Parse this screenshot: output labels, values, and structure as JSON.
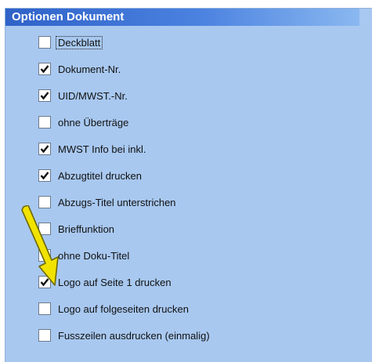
{
  "window": {
    "title": "Optionen Dokument"
  },
  "options": [
    {
      "label": "Deckblatt",
      "checked": false
    },
    {
      "label": "Dokument-Nr.",
      "checked": true
    },
    {
      "label": "UID/MWST.-Nr.",
      "checked": true
    },
    {
      "label": "ohne Überträge",
      "checked": false
    },
    {
      "label": "MWST Info bei inkl.",
      "checked": true
    },
    {
      "label": "Abzugtitel drucken",
      "checked": true
    },
    {
      "label": "Abzugs-Titel unterstrichen",
      "checked": false
    },
    {
      "label": "Brieffunktion",
      "checked": false
    },
    {
      "label": "ohne Doku-Titel",
      "checked": false
    },
    {
      "label": "Logo auf Seite 1 drucken",
      "checked": true
    },
    {
      "label": "Logo auf folgeseiten drucken",
      "checked": false
    },
    {
      "label": "Fusszeilen ausdrucken (einmalig)",
      "checked": false
    }
  ],
  "colors": {
    "panel_background": "#a8c8f0",
    "titlebar_start": "#2f62c8",
    "titlebar_end": "#8ab8f0",
    "annotation_arrow": "#f2e200"
  },
  "annotation": {
    "icon": "yellow-arrow-icon"
  }
}
